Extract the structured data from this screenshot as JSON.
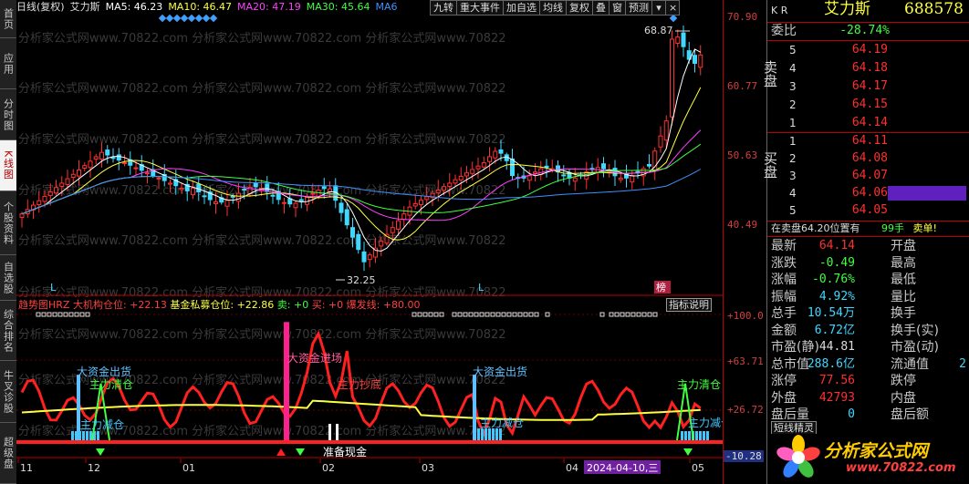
{
  "sidebar": {
    "tabs": [
      {
        "label": "首页",
        "active": false
      },
      {
        "label": "应用",
        "active": false
      },
      {
        "label": "分时图",
        "active": false
      },
      {
        "label": "K线图",
        "active": true
      },
      {
        "label": "个股资料",
        "active": false
      },
      {
        "label": "自选股",
        "active": false
      },
      {
        "label": "综合排名",
        "active": false
      },
      {
        "label": "牛叉诊股",
        "active": false
      },
      {
        "label": "超级盘",
        "active": false
      }
    ]
  },
  "legend": {
    "period": "日线(复权)",
    "name": "艾力斯",
    "ma5": "MA5: 46.23",
    "ma10": "MA10: 46.47",
    "ma20": "MA20: 47.19",
    "ma30": "MA30: 45.64",
    "ma60": "MA6"
  },
  "toolbar": {
    "buttons": [
      "九转",
      "重大事件",
      "加自选",
      "均线",
      "复权",
      "叠",
      "窗",
      "预测"
    ]
  },
  "watermark": "com 分析家公式网www.70822.com 分析家公式网www.70822.com 分析家公式网www.70822",
  "kline": {
    "high_label": "68.87",
    "low_label": "32.25",
    "l_markers": [
      "L",
      "L"
    ],
    "bang": "榜",
    "y_ticks": [
      "70.90",
      "60.77",
      "50.63",
      "40.49"
    ]
  },
  "indicator": {
    "title": "趋势图HRZ",
    "items": [
      "大机构仓位: +22.13",
      "基金私募仓位: +22.86",
      "卖: +0",
      "买: +0",
      "爆发线: +80.00"
    ],
    "explain_button": "指标说明",
    "labels": {
      "da_chu_1": "大资金出货",
      "qing_cang_1": "主力清仓",
      "jian_cang_1": "主力减仓",
      "jin_chang": "大资金进场",
      "chao_di": "主力抄底",
      "zhun_bei": "准备现金",
      "da_chu_2": "大资金出货",
      "jian_cang_2": "主力减仓",
      "qing_cang_2": "主力清仓",
      "jian_cang_3": "主力减仓"
    },
    "y_ticks": [
      "+100.0",
      "+63.71",
      "+26.72",
      "-10.28"
    ]
  },
  "xaxis": {
    "ticks": [
      "11",
      "12",
      "01",
      "02",
      "03",
      "04",
      "05"
    ],
    "cursor_date": "2024-04-10,三"
  },
  "quote": {
    "header": {
      "kr": "K R",
      "name": "艾力斯",
      "code": "688578"
    },
    "weibi": {
      "label": "委比",
      "value": "-28.74%"
    },
    "sell_label": "卖盘",
    "buy_label": "买盘",
    "sell": [
      {
        "lvl": "5",
        "price": "64.19"
      },
      {
        "lvl": "4",
        "price": "64.18"
      },
      {
        "lvl": "3",
        "price": "64.17"
      },
      {
        "lvl": "2",
        "price": "64.15"
      },
      {
        "lvl": "1",
        "price": "64.14"
      }
    ],
    "buy": [
      {
        "lvl": "1",
        "price": "64.11"
      },
      {
        "lvl": "2",
        "price": "64.08"
      },
      {
        "lvl": "3",
        "price": "64.07"
      },
      {
        "lvl": "4",
        "price": "64.06"
      },
      {
        "lvl": "5",
        "price": "64.05"
      }
    ],
    "notice": {
      "text": "在卖盘64.20位置有",
      "qty": "99手",
      "act": "卖单!"
    },
    "stats": [
      {
        "l": "最新",
        "v": "64.14",
        "l2": "开盘",
        "v2": ""
      },
      {
        "l": "涨跌",
        "v": "-0.49",
        "l2": "最高",
        "v2": ""
      },
      {
        "l": "涨幅",
        "v": "-0.76%",
        "l2": "最低",
        "v2": ""
      },
      {
        "l": "振幅",
        "v": "4.92%",
        "l2": "量比",
        "v2": ""
      },
      {
        "l": "总手",
        "v": "10.54万",
        "l2": "换手",
        "v2": ""
      },
      {
        "l": "金额",
        "v": "6.72亿",
        "l2": "换手(实)",
        "v2": ""
      },
      {
        "l": "市盈(静)",
        "v": "44.81",
        "l2": "市盈(动)",
        "v2": ""
      },
      {
        "l": "总市值",
        "v": "288.6亿",
        "l2": "流通值",
        "v2": "2"
      },
      {
        "l": "涨停",
        "v": "77.56",
        "l2": "跌停",
        "v2": ""
      },
      {
        "l": "外盘",
        "v": "42793",
        "l2": "内盘",
        "v2": ""
      },
      {
        "l": "盘后量",
        "v": "0",
        "l2": "盘后额",
        "v2": ""
      }
    ],
    "footer_tab": "短线精灵",
    "logo": {
      "line1": "分析家公式网",
      "line2": "www.70822.com"
    }
  },
  "colors": {
    "up": "#ff3030",
    "down": "#40d8ff",
    "ma5": "#ffffff",
    "ma10": "#ffff40",
    "ma20": "#ff40ff",
    "ma30": "#40ff40",
    "ma60": "#4090ff"
  }
}
